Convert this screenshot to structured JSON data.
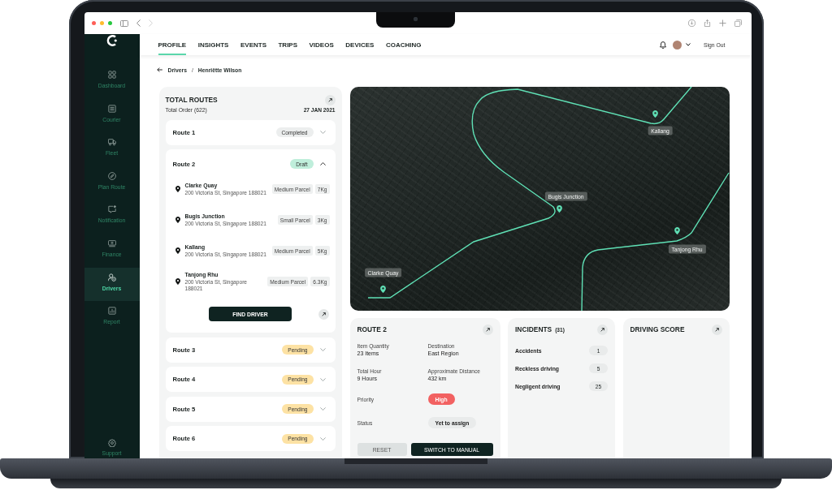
{
  "browser_bar": {
    "back": {
      "disabled": false
    },
    "forward": {
      "disabled": true
    }
  },
  "sidebar": {
    "items": [
      {
        "label": "Dashboard",
        "selected": false
      },
      {
        "label": "Courier",
        "selected": false
      },
      {
        "label": "Fleet",
        "selected": false
      },
      {
        "label": "Plan Route",
        "selected": false
      },
      {
        "label": "Notification",
        "selected": false
      },
      {
        "label": "Finance",
        "selected": false
      },
      {
        "label": "Drivers",
        "selected": true
      },
      {
        "label": "Report",
        "selected": false
      }
    ],
    "footer_item": {
      "label": "Support"
    }
  },
  "top_nav": {
    "tabs": [
      {
        "label": "PROFILE",
        "selected": true
      },
      {
        "label": "INSIGHTS",
        "selected": false
      },
      {
        "label": "EVENTS",
        "selected": false
      },
      {
        "label": "TRIPS",
        "selected": false
      },
      {
        "label": "VIDEOS",
        "selected": false
      },
      {
        "label": "DEVICES",
        "selected": false
      },
      {
        "label": "COACHING",
        "selected": false
      }
    ],
    "sign_out": "Sign Out"
  },
  "breadcrumb": {
    "items": [
      "Drivers",
      "Henriëtte Wilson"
    ],
    "separator": "/"
  },
  "routes_panel": {
    "title": "TOTAL ROUTES",
    "subtitle": "Total Order (622)",
    "date": "27 JAN 2021",
    "routes": [
      {
        "name": "Route 1",
        "status": "Completed",
        "color": "#eceeee",
        "expanded": false
      },
      {
        "name": "Route 2",
        "status": "Draft",
        "color": "#bfeedb",
        "expanded": true,
        "stops": [
          {
            "name": "Clarke Quay",
            "address": "200 Victoria St, Singapore 188021",
            "parcel": "Medium Parcel",
            "weight": "7Kg"
          },
          {
            "name": "Bugis Junction",
            "address": "200 Victoria St, Singapore 188021",
            "parcel": "Small Parcel",
            "weight": "3Kg"
          },
          {
            "name": "Kallang",
            "address": "200 Victoria St, Singapore 188021",
            "parcel": "Medium Parcel",
            "weight": "5Kg"
          },
          {
            "name": "Tanjong Rhu",
            "address": "200 Victoria St, Singapore 188021",
            "parcel": "Medium Parcel",
            "weight": "6.3Kg"
          }
        ],
        "action": "FIND DRIVER"
      },
      {
        "name": "Route 3",
        "status": "Pending",
        "color": "#fde2a4",
        "expanded": false
      },
      {
        "name": "Route 4",
        "status": "Pending",
        "color": "#fde2a4",
        "expanded": false
      },
      {
        "name": "Route 5",
        "status": "Pending",
        "color": "#fde2a4",
        "expanded": false
      },
      {
        "name": "Route 6",
        "status": "Pending",
        "color": "#fde2a4",
        "expanded": false
      }
    ]
  },
  "map": {
    "markers": [
      {
        "label": "Clarke Quay"
      },
      {
        "label": "Bugis Junction"
      },
      {
        "label": "Kallang"
      },
      {
        "label": "Tanjong Rhu"
      }
    ]
  },
  "route_summary": {
    "title": "ROUTE 2",
    "fields": [
      {
        "label": "Item Quantity",
        "value": "23 Items"
      },
      {
        "label": "Destination",
        "value": "East Region"
      },
      {
        "label": "Total Hour",
        "value": "9 Hours"
      },
      {
        "label": "Approximate Distance",
        "value": "432 km"
      }
    ],
    "rows": [
      {
        "label": "Priority",
        "value": "High",
        "kind": "alert"
      },
      {
        "label": "Status",
        "value": "Yet to assign",
        "kind": "neutral"
      }
    ],
    "buttons": [
      {
        "label": "RESET",
        "kind": "secondary"
      },
      {
        "label": "SWITCH TO MANUAL",
        "kind": "primary"
      }
    ]
  },
  "incidents": {
    "title": "INCIDENTS",
    "total": "(31)",
    "items": [
      {
        "label": "Accidents",
        "count": "1"
      },
      {
        "label": "Reckless driving",
        "count": "5"
      },
      {
        "label": "Negligent driving",
        "count": "25"
      }
    ]
  },
  "driving_score": {
    "title": "DRIVING SCORE"
  }
}
